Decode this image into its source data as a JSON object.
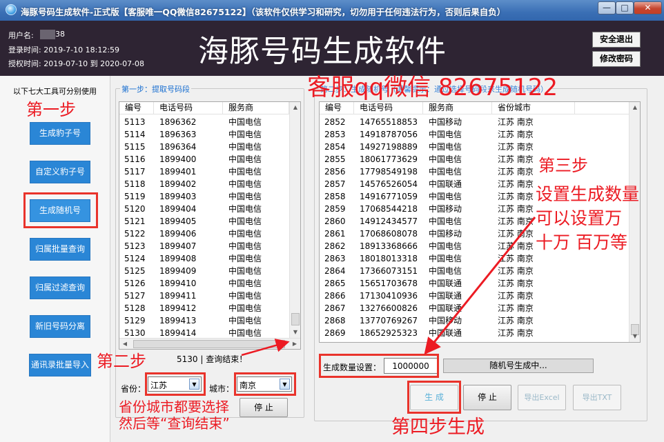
{
  "window": {
    "title": "海豚号码生成软件-正式版【客服唯一QQ微信82675122】（该软件仅供学习和研究，切勿用于任何违法行为，否则后果自负）",
    "min_glyph": "—",
    "max_glyph": "□",
    "close_glyph": "✕"
  },
  "header": {
    "username_label": "用户名:",
    "username_tail": "38",
    "login_time": "登录时间: 2019-7-10 18:12:59",
    "license_time": "授权时间: 2019-07-10 到 2020-07-08",
    "app_title": "海豚号码生成软件",
    "exit_button": "安全退出",
    "password_button": "修改密码"
  },
  "sidebar": {
    "caption": "以下七大工具可分别使用",
    "tools": [
      "生成豹子号",
      "自定义豹子号",
      "生成随机号",
      "归属批量查询",
      "归属过滤查询",
      "新旧号码分离",
      "通讯录批量导入"
    ]
  },
  "step1": {
    "caption": "第一步：提取号码段",
    "columns": [
      "编号",
      "电话号码",
      "服务商"
    ],
    "rows": [
      [
        "5113",
        "1896362",
        "中国电信"
      ],
      [
        "5114",
        "1896363",
        "中国电信"
      ],
      [
        "5115",
        "1896364",
        "中国电信"
      ],
      [
        "5116",
        "1899400",
        "中国电信"
      ],
      [
        "5117",
        "1899401",
        "中国电信"
      ],
      [
        "5118",
        "1899402",
        "中国电信"
      ],
      [
        "5119",
        "1899403",
        "中国电信"
      ],
      [
        "5120",
        "1899404",
        "中国电信"
      ],
      [
        "5121",
        "1899405",
        "中国电信"
      ],
      [
        "5122",
        "1899406",
        "中国电信"
      ],
      [
        "5123",
        "1899407",
        "中国电信"
      ],
      [
        "5124",
        "1899408",
        "中国电信"
      ],
      [
        "5125",
        "1899409",
        "中国电信"
      ],
      [
        "5126",
        "1899410",
        "中国电信"
      ],
      [
        "5127",
        "1899411",
        "中国电信"
      ],
      [
        "5128",
        "1899412",
        "中国电信"
      ],
      [
        "5129",
        "1899413",
        "中国电信"
      ],
      [
        "5130",
        "1899414",
        "中国电信"
      ]
    ],
    "status": "5130 | 查询结束！",
    "province_label": "省份：",
    "province_value": "江苏",
    "city_label": "城市：",
    "city_value": "南京",
    "stop_button": "停 止"
  },
  "step2": {
    "caption": "第二步：生成随机号（温馨提示：通过选择号码段来生成随机号码）",
    "columns": [
      "编号",
      "电话号码",
      "服务商",
      "省份城市"
    ],
    "rows": [
      [
        "2852",
        "14765518853",
        "中国移动",
        "江苏 南京"
      ],
      [
        "2853",
        "14918787056",
        "中国电信",
        "江苏 南京"
      ],
      [
        "2854",
        "14927198889",
        "中国电信",
        "江苏 南京"
      ],
      [
        "2855",
        "18061773629",
        "中国电信",
        "江苏 南京"
      ],
      [
        "2856",
        "17798549198",
        "中国电信",
        "江苏 南京"
      ],
      [
        "2857",
        "14576526054",
        "中国联通",
        "江苏 南京"
      ],
      [
        "2858",
        "14916771059",
        "中国电信",
        "江苏 南京"
      ],
      [
        "2859",
        "17068544218",
        "中国移动",
        "江苏 南京"
      ],
      [
        "2860",
        "14912434577",
        "中国电信",
        "江苏 南京"
      ],
      [
        "2861",
        "17068608078",
        "中国移动",
        "江苏 南京"
      ],
      [
        "2862",
        "18913368666",
        "中国电信",
        "江苏 南京"
      ],
      [
        "2863",
        "18018013318",
        "中国电信",
        "江苏 南京"
      ],
      [
        "2864",
        "17366073151",
        "中国电信",
        "江苏 南京"
      ],
      [
        "2865",
        "15651703678",
        "中国联通",
        "江苏 南京"
      ],
      [
        "2866",
        "17130410936",
        "中国联通",
        "江苏 南京"
      ],
      [
        "2867",
        "13276600826",
        "中国联通",
        "江苏 南京"
      ],
      [
        "2868",
        "13770769267",
        "中国移动",
        "江苏 南京"
      ],
      [
        "2869",
        "18652925323",
        "中国联通",
        "江苏 南京"
      ]
    ],
    "count_label": "生成数量设置：",
    "count_value": "1000000",
    "progress_text": "随机号生成中...",
    "generate_button": "生 成",
    "stop_button": "停 止",
    "export_excel_button": "导出Excel",
    "export_txt_button": "导出TXT"
  },
  "annotations": {
    "step_one": "第一步",
    "step_two": "第二步",
    "step_three": "第三步",
    "step_three_note_1": "设置生成数量",
    "step_three_note_2": "可以设置万",
    "step_three_note_3": "十万  百万等",
    "province_note_1": "省份城市都要选择",
    "province_note_2": "然后等“查询结束”",
    "step_four": "第四步生成",
    "contact": "客服qq微信 82675122",
    "color": "#ec1b23"
  },
  "theme": {
    "titlebar": "#3a6fb5",
    "header_bg": "#2e2433",
    "tool_button": "#2a86d6",
    "caption_blue": "#1a6fd0"
  }
}
